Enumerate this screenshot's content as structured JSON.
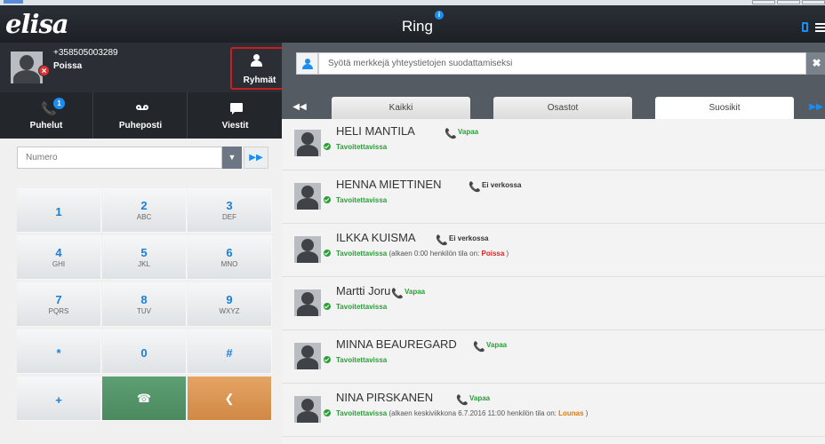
{
  "app": {
    "logo": "elisa",
    "title": "Ring"
  },
  "me": {
    "number": "+358505003289",
    "status": "Poissa",
    "groups_label": "Ryhmät"
  },
  "left_tabs": [
    {
      "label": "Puhelut",
      "badge": "1"
    },
    {
      "label": "Puheposti"
    },
    {
      "label": "Viestit"
    }
  ],
  "dialer": {
    "number_placeholder": "Numero",
    "keys": [
      {
        "digit": "1",
        "letters": ""
      },
      {
        "digit": "2",
        "letters": "ABC"
      },
      {
        "digit": "3",
        "letters": "DEF"
      },
      {
        "digit": "4",
        "letters": "GHI"
      },
      {
        "digit": "5",
        "letters": "JKL"
      },
      {
        "digit": "6",
        "letters": "MNO"
      },
      {
        "digit": "7",
        "letters": "PQRS"
      },
      {
        "digit": "8",
        "letters": "TUV"
      },
      {
        "digit": "9",
        "letters": "WXYZ"
      },
      {
        "digit": "*",
        "letters": ""
      },
      {
        "digit": "0",
        "letters": ""
      },
      {
        "digit": "#",
        "letters": ""
      },
      {
        "digit": "+",
        "letters": ""
      }
    ]
  },
  "filter": {
    "placeholder": "Syötä merkkejä yhteystietojen suodattamiseksi",
    "clear_label": "✖"
  },
  "contact_tabs": [
    "Kaikki",
    "Osastot",
    "Suosikit"
  ],
  "contacts": [
    {
      "name": "HELI MANTILA",
      "phone_status": "Vapaa",
      "phone_status_color": "#2a9e38",
      "availability": "Tavoitettavissa",
      "note_pre": "",
      "note_status": "",
      "note_post": ""
    },
    {
      "name": "HENNA MIETTINEN",
      "phone_status": "Ei verkossa",
      "phone_status_color": "#333333",
      "availability": "Tavoitettavissa",
      "note_pre": "",
      "note_status": "",
      "note_post": ""
    },
    {
      "name": "ILKKA KUISMA",
      "phone_status": "Ei verkossa",
      "phone_status_color": "#333333",
      "availability": "Tavoitettavissa",
      "note_pre": " (alkaen 0:00 henkilön tila on: ",
      "note_status": "Poissa",
      "note_post": " )"
    },
    {
      "name": "Martti Joru",
      "phone_status": "Vapaa",
      "phone_status_color": "#2a9e38",
      "availability": "Tavoitettavissa",
      "note_pre": "",
      "note_status": "",
      "note_post": ""
    },
    {
      "name": "MINNA BEAUREGARD",
      "phone_status": "Vapaa",
      "phone_status_color": "#2a9e38",
      "availability": "Tavoitettavissa",
      "note_pre": "",
      "note_status": "",
      "note_post": ""
    },
    {
      "name": "NINA PIRSKANEN",
      "phone_status": "Vapaa",
      "phone_status_color": "#2a9e38",
      "availability": "Tavoitettavissa",
      "note_pre": " (alkaen keskiviikkona 6.7.2016 11:00 henkilön tila on: ",
      "note_status": "Lounas",
      "note_post": " )"
    }
  ],
  "colors": {
    "accent": "#1a8ef0",
    "available": "#2a9e38",
    "busy": "#dd2222",
    "lunch": "#e07a10",
    "call_button": "#4a8a5e",
    "back_button": "#d08845",
    "highlight_box": "#c9201e"
  }
}
